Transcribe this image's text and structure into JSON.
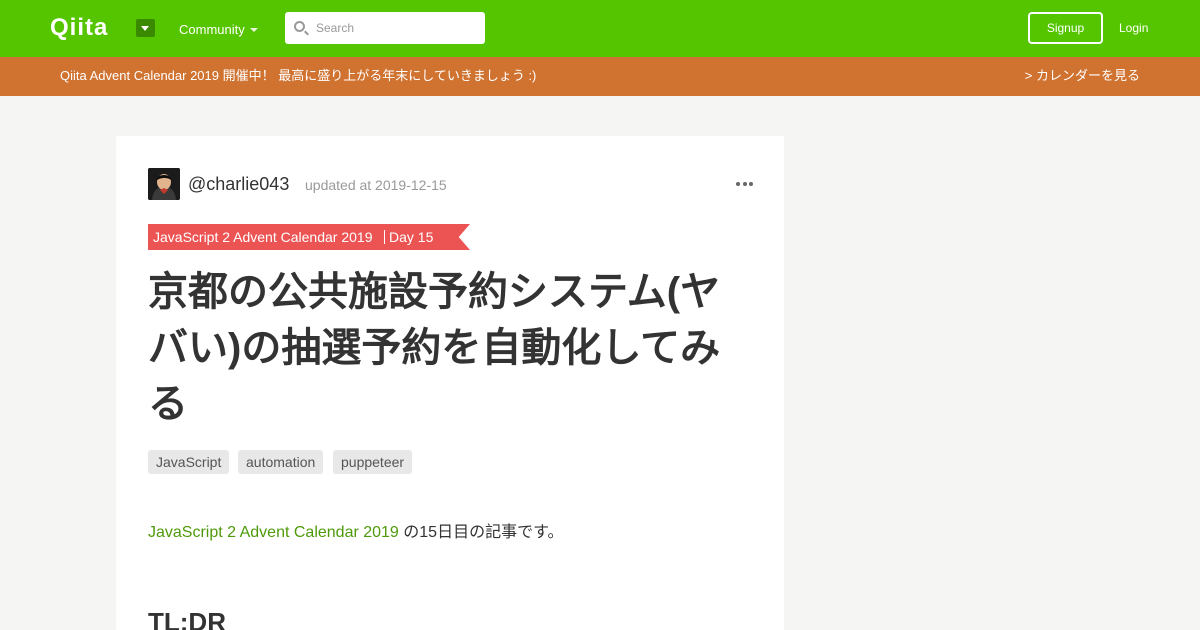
{
  "header": {
    "logo_text": "Qiita",
    "community_label": "Community",
    "search_placeholder": "Search",
    "signup_label": "Signup",
    "login_label": "Login"
  },
  "banner": {
    "text": "Qiita Advent Calendar 2019 開催中！ 最高に盛り上がる年末にしていきましょう :)",
    "link": "> カレンダーを見る"
  },
  "article": {
    "author": "@charlie043",
    "updated": "updated at 2019-12-15",
    "calendar": "JavaScript 2 Advent Calendar 2019",
    "day": "Day 15",
    "title": "京都の公共施設予約システム(ヤバい)の抽選予約を自動化してみる",
    "tags": [
      "JavaScript",
      "automation",
      "puppeteer"
    ],
    "intro_link": "JavaScript 2 Advent Calendar 2019",
    "intro_suffix": " の15日目の記事です。",
    "heading": "TL;DR"
  },
  "colors": {
    "brand": "#55c500",
    "banner": "#d07230",
    "ribbon": "#ec5454",
    "link": "#4f9a0a"
  },
  "icons": [
    "search-icon",
    "dropdown-caret-icon",
    "more-options-icon"
  ]
}
